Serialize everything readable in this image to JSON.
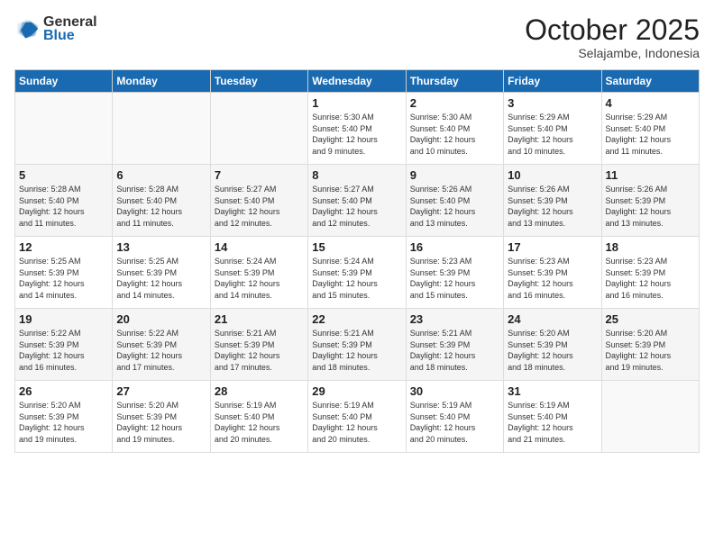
{
  "header": {
    "logo_general": "General",
    "logo_blue": "Blue",
    "month": "October 2025",
    "location": "Selajambe, Indonesia"
  },
  "days_of_week": [
    "Sunday",
    "Monday",
    "Tuesday",
    "Wednesday",
    "Thursday",
    "Friday",
    "Saturday"
  ],
  "weeks": [
    [
      {
        "day": "",
        "info": ""
      },
      {
        "day": "",
        "info": ""
      },
      {
        "day": "",
        "info": ""
      },
      {
        "day": "1",
        "info": "Sunrise: 5:30 AM\nSunset: 5:40 PM\nDaylight: 12 hours\nand 9 minutes."
      },
      {
        "day": "2",
        "info": "Sunrise: 5:30 AM\nSunset: 5:40 PM\nDaylight: 12 hours\nand 10 minutes."
      },
      {
        "day": "3",
        "info": "Sunrise: 5:29 AM\nSunset: 5:40 PM\nDaylight: 12 hours\nand 10 minutes."
      },
      {
        "day": "4",
        "info": "Sunrise: 5:29 AM\nSunset: 5:40 PM\nDaylight: 12 hours\nand 11 minutes."
      }
    ],
    [
      {
        "day": "5",
        "info": "Sunrise: 5:28 AM\nSunset: 5:40 PM\nDaylight: 12 hours\nand 11 minutes."
      },
      {
        "day": "6",
        "info": "Sunrise: 5:28 AM\nSunset: 5:40 PM\nDaylight: 12 hours\nand 11 minutes."
      },
      {
        "day": "7",
        "info": "Sunrise: 5:27 AM\nSunset: 5:40 PM\nDaylight: 12 hours\nand 12 minutes."
      },
      {
        "day": "8",
        "info": "Sunrise: 5:27 AM\nSunset: 5:40 PM\nDaylight: 12 hours\nand 12 minutes."
      },
      {
        "day": "9",
        "info": "Sunrise: 5:26 AM\nSunset: 5:40 PM\nDaylight: 12 hours\nand 13 minutes."
      },
      {
        "day": "10",
        "info": "Sunrise: 5:26 AM\nSunset: 5:39 PM\nDaylight: 12 hours\nand 13 minutes."
      },
      {
        "day": "11",
        "info": "Sunrise: 5:26 AM\nSunset: 5:39 PM\nDaylight: 12 hours\nand 13 minutes."
      }
    ],
    [
      {
        "day": "12",
        "info": "Sunrise: 5:25 AM\nSunset: 5:39 PM\nDaylight: 12 hours\nand 14 minutes."
      },
      {
        "day": "13",
        "info": "Sunrise: 5:25 AM\nSunset: 5:39 PM\nDaylight: 12 hours\nand 14 minutes."
      },
      {
        "day": "14",
        "info": "Sunrise: 5:24 AM\nSunset: 5:39 PM\nDaylight: 12 hours\nand 14 minutes."
      },
      {
        "day": "15",
        "info": "Sunrise: 5:24 AM\nSunset: 5:39 PM\nDaylight: 12 hours\nand 15 minutes."
      },
      {
        "day": "16",
        "info": "Sunrise: 5:23 AM\nSunset: 5:39 PM\nDaylight: 12 hours\nand 15 minutes."
      },
      {
        "day": "17",
        "info": "Sunrise: 5:23 AM\nSunset: 5:39 PM\nDaylight: 12 hours\nand 16 minutes."
      },
      {
        "day": "18",
        "info": "Sunrise: 5:23 AM\nSunset: 5:39 PM\nDaylight: 12 hours\nand 16 minutes."
      }
    ],
    [
      {
        "day": "19",
        "info": "Sunrise: 5:22 AM\nSunset: 5:39 PM\nDaylight: 12 hours\nand 16 minutes."
      },
      {
        "day": "20",
        "info": "Sunrise: 5:22 AM\nSunset: 5:39 PM\nDaylight: 12 hours\nand 17 minutes."
      },
      {
        "day": "21",
        "info": "Sunrise: 5:21 AM\nSunset: 5:39 PM\nDaylight: 12 hours\nand 17 minutes."
      },
      {
        "day": "22",
        "info": "Sunrise: 5:21 AM\nSunset: 5:39 PM\nDaylight: 12 hours\nand 18 minutes."
      },
      {
        "day": "23",
        "info": "Sunrise: 5:21 AM\nSunset: 5:39 PM\nDaylight: 12 hours\nand 18 minutes."
      },
      {
        "day": "24",
        "info": "Sunrise: 5:20 AM\nSunset: 5:39 PM\nDaylight: 12 hours\nand 18 minutes."
      },
      {
        "day": "25",
        "info": "Sunrise: 5:20 AM\nSunset: 5:39 PM\nDaylight: 12 hours\nand 19 minutes."
      }
    ],
    [
      {
        "day": "26",
        "info": "Sunrise: 5:20 AM\nSunset: 5:39 PM\nDaylight: 12 hours\nand 19 minutes."
      },
      {
        "day": "27",
        "info": "Sunrise: 5:20 AM\nSunset: 5:39 PM\nDaylight: 12 hours\nand 19 minutes."
      },
      {
        "day": "28",
        "info": "Sunrise: 5:19 AM\nSunset: 5:40 PM\nDaylight: 12 hours\nand 20 minutes."
      },
      {
        "day": "29",
        "info": "Sunrise: 5:19 AM\nSunset: 5:40 PM\nDaylight: 12 hours\nand 20 minutes."
      },
      {
        "day": "30",
        "info": "Sunrise: 5:19 AM\nSunset: 5:40 PM\nDaylight: 12 hours\nand 20 minutes."
      },
      {
        "day": "31",
        "info": "Sunrise: 5:19 AM\nSunset: 5:40 PM\nDaylight: 12 hours\nand 21 minutes."
      },
      {
        "day": "",
        "info": ""
      }
    ]
  ]
}
